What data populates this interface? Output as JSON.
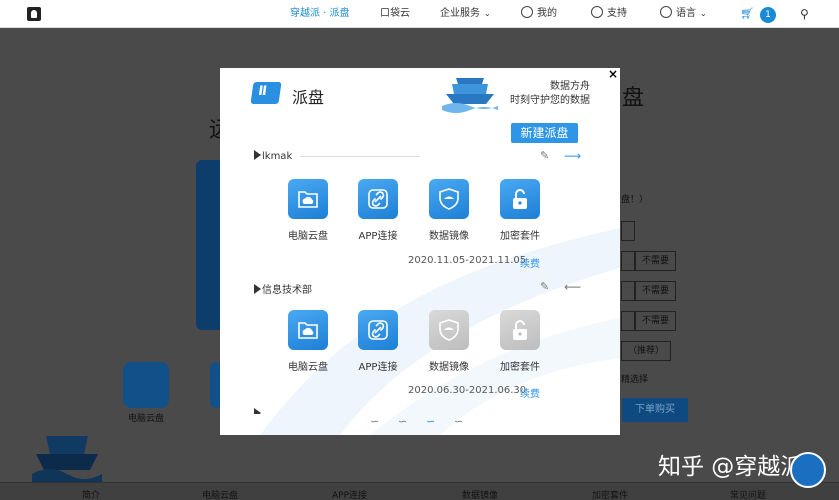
{
  "topnav": {
    "items": [
      {
        "label": "穿越派 · 派盘",
        "active": true
      },
      {
        "label": "口袋云"
      },
      {
        "label": "企业服务",
        "caret": "⌄"
      },
      {
        "label": "我的",
        "icon": "user-icon"
      },
      {
        "label": "支持",
        "icon": "support-icon"
      },
      {
        "label": "语言",
        "icon": "globe-icon",
        "caret": "⌄"
      }
    ],
    "cart_count": "1",
    "cart_icon": "cart-icon",
    "search_icon": "search-icon"
  },
  "background_page": {
    "heading_right": "盘",
    "heading_left": "远",
    "text_fragments": [
      "盘！）",
      "（推荐）",
      "精选择",
      "电脑云盘"
    ],
    "option_buttons": [
      "不需要",
      "不需要",
      "不需要",
      "不需要"
    ],
    "bottom_tabs": [
      "简介",
      "电脑云盘",
      "APP连接",
      "数据镜像",
      "加密套件",
      "常见问题"
    ],
    "order_button": "下单购买",
    "watermark": "知乎 @穿越派"
  },
  "modal": {
    "brand_title": "派盘",
    "tagline_line1": "数据方舟",
    "tagline_line2": "时刻守护您的数据",
    "new_button": "新建派盘",
    "close_symbol": "×",
    "sections": [
      {
        "name": "lkmak",
        "apps": [
          {
            "label": "电脑云盘",
            "icon": "cloud-folder-icon",
            "enabled": true
          },
          {
            "label": "APP连接",
            "icon": "link-icon",
            "enabled": true
          },
          {
            "label": "数据镜像",
            "icon": "shield-icon",
            "enabled": true
          },
          {
            "label": "加密套件",
            "icon": "lock-icon",
            "enabled": true
          }
        ],
        "date_range": "2020.11.05-2021.11.05",
        "renew": "续费"
      },
      {
        "name": "信息技术部",
        "apps": [
          {
            "label": "电脑云盘",
            "icon": "cloud-folder-icon",
            "enabled": true
          },
          {
            "label": "APP连接",
            "icon": "link-icon",
            "enabled": true
          },
          {
            "label": "数据镜像",
            "icon": "shield-icon",
            "enabled": false
          },
          {
            "label": "加密套件",
            "icon": "lock-icon",
            "enabled": false
          }
        ],
        "date_range": "2020.06.30-2021.06.30",
        "renew": "续费"
      }
    ],
    "pager": [
      "∽",
      "∽",
      "∽",
      "∽"
    ],
    "pager_active_index": 2
  },
  "colors": {
    "accent": "#2f95e6",
    "disabled": "#c8c8c8",
    "overlay": "#4a4a4a"
  }
}
